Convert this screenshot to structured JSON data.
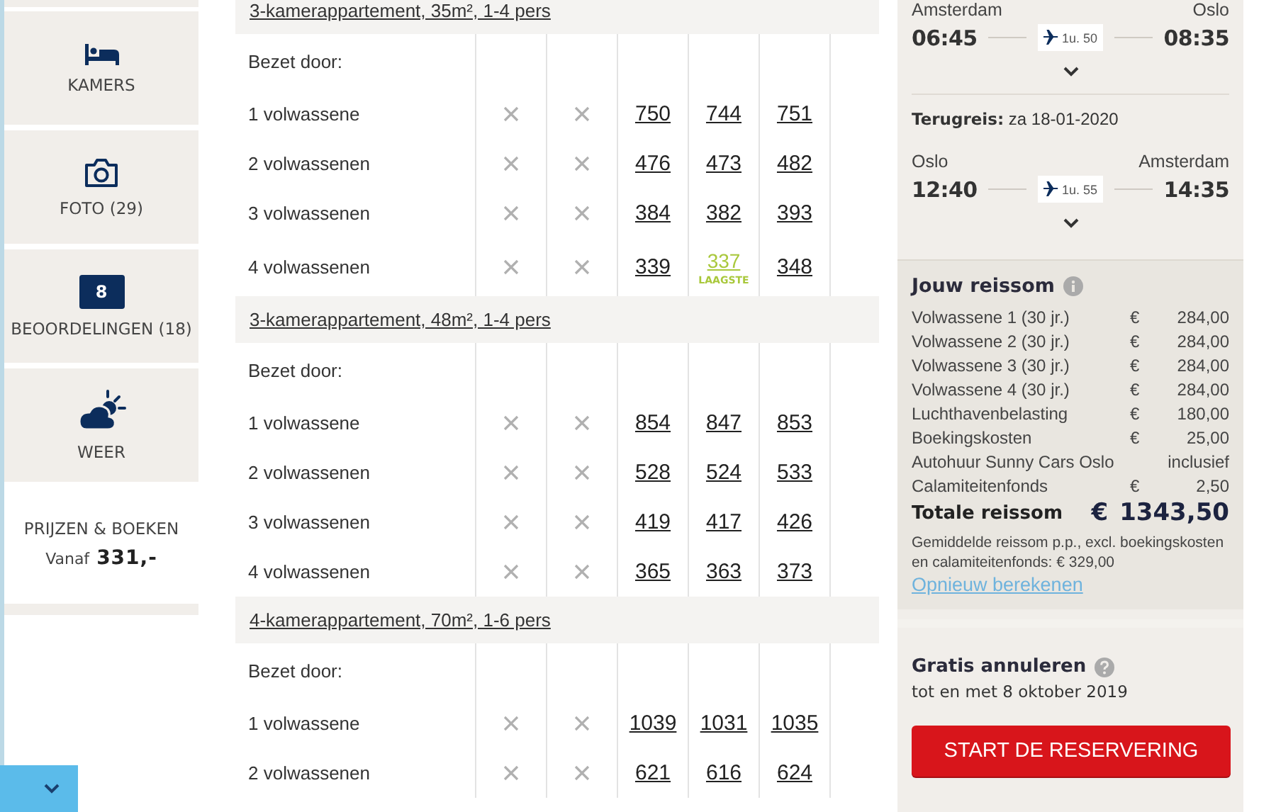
{
  "sidebar": {
    "items": [
      {
        "kind": "bed",
        "label": "KAMERS"
      },
      {
        "kind": "camera",
        "label": "FOTO (29)"
      },
      {
        "kind": "score",
        "score": "8",
        "label": "BEOORDELINGEN (18)"
      },
      {
        "kind": "weather",
        "label": "WEER"
      }
    ],
    "booking": {
      "title": "PRIJZEN & BOEKEN",
      "prefix": "Vanaf",
      "price": "331,-"
    }
  },
  "rooms": [
    {
      "title": "3-kamerappartement, 35m², 1-4 pers",
      "occupied_label": "Bezet door:",
      "rows": [
        {
          "label": "1 volwassene",
          "cells": [
            {
              "kind": "unavailable"
            },
            {
              "kind": "unavailable"
            },
            {
              "kind": "price",
              "text": "750"
            },
            {
              "kind": "price",
              "text": "744"
            },
            {
              "kind": "price",
              "text": "751"
            }
          ]
        },
        {
          "label": "2 volwassenen",
          "cells": [
            {
              "kind": "unavailable"
            },
            {
              "kind": "unavailable"
            },
            {
              "kind": "price",
              "text": "476"
            },
            {
              "kind": "price",
              "text": "473"
            },
            {
              "kind": "price",
              "text": "482"
            }
          ]
        },
        {
          "label": "3 volwassenen",
          "cells": [
            {
              "kind": "unavailable"
            },
            {
              "kind": "unavailable"
            },
            {
              "kind": "price",
              "text": "384"
            },
            {
              "kind": "price",
              "text": "382"
            },
            {
              "kind": "price",
              "text": "393"
            }
          ]
        },
        {
          "label": "4 volwassenen",
          "cells": [
            {
              "kind": "unavailable"
            },
            {
              "kind": "unavailable"
            },
            {
              "kind": "price",
              "text": "339"
            },
            {
              "kind": "lowest",
              "text": "337",
              "badge": "LAAGSTE"
            },
            {
              "kind": "price",
              "text": "348"
            }
          ]
        }
      ]
    },
    {
      "title": "3-kamerappartement, 48m², 1-4 pers",
      "occupied_label": "Bezet door:",
      "rows": [
        {
          "label": "1 volwassene",
          "cells": [
            {
              "kind": "unavailable"
            },
            {
              "kind": "unavailable"
            },
            {
              "kind": "price",
              "text": "854"
            },
            {
              "kind": "price",
              "text": "847"
            },
            {
              "kind": "price",
              "text": "853"
            }
          ]
        },
        {
          "label": "2 volwassenen",
          "cells": [
            {
              "kind": "unavailable"
            },
            {
              "kind": "unavailable"
            },
            {
              "kind": "price",
              "text": "528"
            },
            {
              "kind": "price",
              "text": "524"
            },
            {
              "kind": "price",
              "text": "533"
            }
          ]
        },
        {
          "label": "3 volwassenen",
          "cells": [
            {
              "kind": "unavailable"
            },
            {
              "kind": "unavailable"
            },
            {
              "kind": "price",
              "text": "419"
            },
            {
              "kind": "price",
              "text": "417"
            },
            {
              "kind": "price",
              "text": "426"
            }
          ]
        },
        {
          "label": "4 volwassenen",
          "cells": [
            {
              "kind": "unavailable"
            },
            {
              "kind": "unavailable"
            },
            {
              "kind": "price",
              "text": "365"
            },
            {
              "kind": "price",
              "text": "363"
            },
            {
              "kind": "price",
              "text": "373"
            }
          ]
        }
      ]
    },
    {
      "title": "4-kamerappartement, 70m², 1-6 pers",
      "occupied_label": "Bezet door:",
      "rows": [
        {
          "label": "1 volwassene",
          "cells": [
            {
              "kind": "unavailable"
            },
            {
              "kind": "unavailable"
            },
            {
              "kind": "price",
              "text": "1039"
            },
            {
              "kind": "price",
              "text": "1031"
            },
            {
              "kind": "price",
              "text": "1035"
            }
          ]
        },
        {
          "label": "2 volwassenen",
          "cells": [
            {
              "kind": "unavailable"
            },
            {
              "kind": "unavailable"
            },
            {
              "kind": "price",
              "text": "621"
            },
            {
              "kind": "price",
              "text": "616"
            },
            {
              "kind": "price",
              "text": "624"
            }
          ]
        }
      ]
    }
  ],
  "flights": {
    "outbound": {
      "from": "Amsterdam",
      "to": "Oslo",
      "depart": "06:45",
      "arrive": "08:35",
      "duration": "1u. 50"
    },
    "return": {
      "label": "Terugreis:",
      "date": "za 18-01-2020",
      "from": "Oslo",
      "to": "Amsterdam",
      "depart": "12:40",
      "arrive": "14:35",
      "duration": "1u. 55"
    }
  },
  "summary": {
    "title": "Jouw reissom",
    "lines": [
      {
        "label": "Volwassene 1 (30 jr.)",
        "currency": "€",
        "amount": "284,00"
      },
      {
        "label": "Volwassene 2 (30 jr.)",
        "currency": "€",
        "amount": "284,00"
      },
      {
        "label": "Volwassene 3 (30 jr.)",
        "currency": "€",
        "amount": "284,00"
      },
      {
        "label": "Volwassene 4 (30 jr.)",
        "currency": "€",
        "amount": "284,00"
      },
      {
        "label": "Luchthavenbelasting",
        "currency": "€",
        "amount": "180,00"
      },
      {
        "label": "Boekingskosten",
        "currency": "€",
        "amount": "25,00"
      },
      {
        "label": "Autohuur Sunny Cars Oslo",
        "amount": "inclusief"
      },
      {
        "label": "Calamiteitenfonds",
        "currency": "€",
        "amount": "2,50"
      }
    ],
    "total": {
      "label": "Totale reissom",
      "currency": "€",
      "amount": "1343,50"
    },
    "note": "Gemiddelde reissom p.p., excl. boekingskosten en calamiteitenfonds: € 329,00",
    "link": "Opnieuw berekenen"
  },
  "cancellation": {
    "title": "Gratis annuleren",
    "subtitle": "tot en met 8 oktober 2019"
  },
  "book_button": "START DE RESERVERING"
}
